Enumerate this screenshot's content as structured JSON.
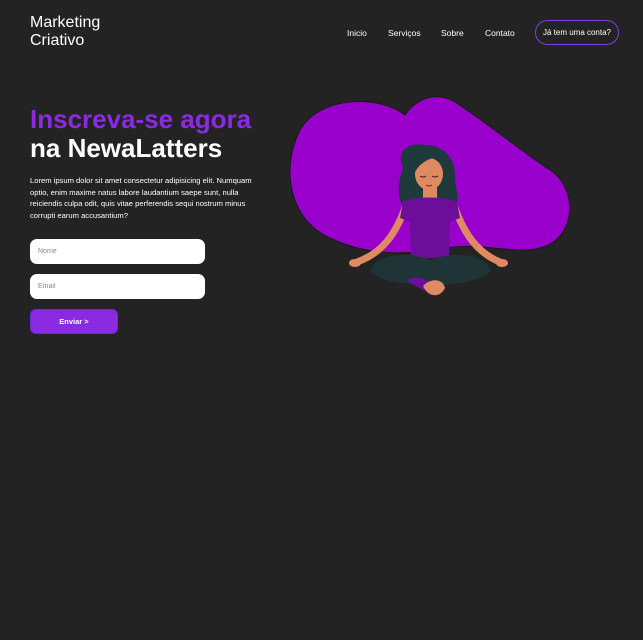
{
  "header": {
    "logo_line1": "Marketing",
    "logo_line2": "Criativo",
    "nav": [
      {
        "label": "Inicio"
      },
      {
        "label": "Serviços"
      },
      {
        "label": "Sobre"
      },
      {
        "label": "Contato"
      }
    ],
    "account_label": "Já tem uma conta?"
  },
  "hero": {
    "title_accent": "Inscreva-se agora",
    "title_main": "na NewaLatters",
    "lead": "Lorem ipsum dolor sit amet consectetur adipisicing elit. Numquam optio, enim maxime natus labore laudantium saepe sunt, nulla reiciendis culpa odit, quis vitae perferendis sequi nostrum minus corrupti earum accusantium?"
  },
  "form": {
    "name_placeholder": "Nome",
    "email_placeholder": "Email",
    "submit_label": "Enviar >"
  },
  "colors": {
    "background": "#232323",
    "accent": "#8a2be2",
    "blob": "#9900cc",
    "text": "#ffffff"
  },
  "illustration": {
    "icon": "meditating-woman-illustration"
  }
}
